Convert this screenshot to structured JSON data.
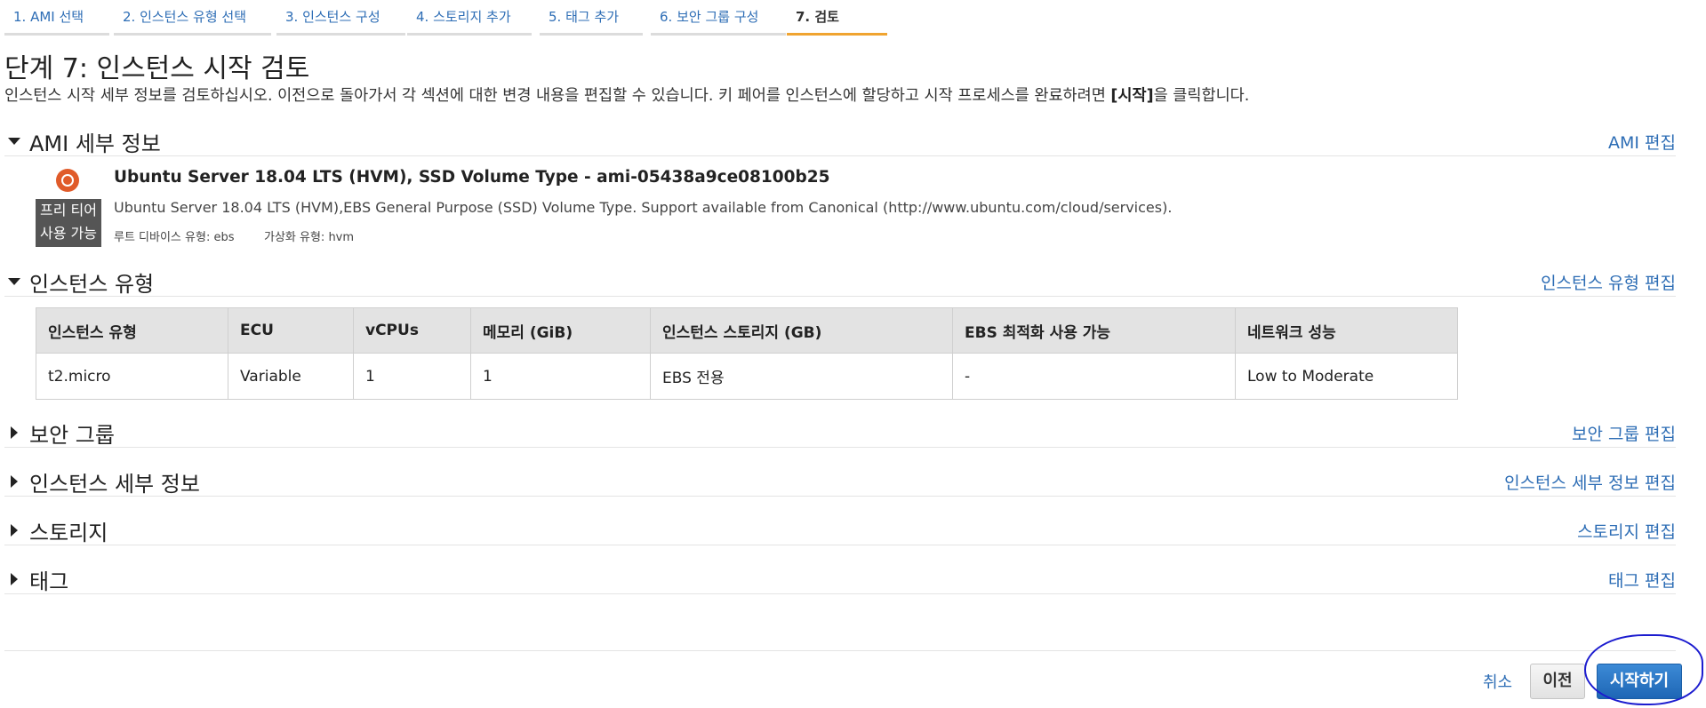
{
  "tabs": [
    {
      "label": "1. AMI 선택"
    },
    {
      "label": "2. 인스턴스 유형 선택"
    },
    {
      "label": "3. 인스턴스 구성"
    },
    {
      "label": "4. 스토리지 추가"
    },
    {
      "label": "5. 태그 추가"
    },
    {
      "label": "6. 보안 그룹 구성"
    },
    {
      "label": "7. 검토"
    }
  ],
  "active_tab_color": "#f0a430",
  "link_color": "#2d6db5",
  "page": {
    "title": "단계 7: 인스턴스 시작 검토",
    "desc_before": "인스턴스 시작 세부 정보를 검토하십시오. 이전으로 돌아가서 각 섹션에 대한 변경 내용을 편집할 수 있습니다. 키 페어를 인스턴스에 할당하고 시작 프로세스를 완료하려면 ",
    "desc_bold": "[시작]",
    "desc_after": "을 클릭합니다."
  },
  "sections": {
    "ami": {
      "title": "AMI 세부 정보",
      "edit": "AMI 편집",
      "expanded": true
    },
    "instance_type": {
      "title": "인스턴스 유형",
      "edit": "인스턴스 유형 편집",
      "expanded": true
    },
    "security_group": {
      "title": "보안 그룹",
      "edit": "보안 그룹 편집",
      "expanded": false
    },
    "instance_details": {
      "title": "인스턴스 세부 정보",
      "edit": "인스턴스 세부 정보 편집",
      "expanded": false
    },
    "storage": {
      "title": "스토리지",
      "edit": "스토리지 편집",
      "expanded": false
    },
    "tags": {
      "title": "태그",
      "edit": "태그 편집",
      "expanded": false
    }
  },
  "ami": {
    "icon": "ubuntu-logo-icon",
    "badge_line1": "프리 티어",
    "badge_line2": "사용 가능",
    "name": "Ubuntu Server 18.04 LTS (HVM), SSD Volume Type - ami-05438a9ce08100b25",
    "description": "Ubuntu Server 18.04 LTS (HVM),EBS General Purpose (SSD) Volume Type. Support available from Canonical (http://www.ubuntu.com/cloud/services).",
    "root_device": "루트 디바이스 유형: ebs",
    "virtualization": "가상화 유형: hvm"
  },
  "instance_table": {
    "headers": [
      "인스턴스 유형",
      "ECU",
      "vCPUs",
      "메모리 (GiB)",
      "인스턴스 스토리지 (GB)",
      "EBS 최적화 사용 가능",
      "네트워크 성능"
    ],
    "rows": [
      [
        "t2.micro",
        "Variable",
        "1",
        "1",
        "EBS 전용",
        "-",
        "Low to Moderate"
      ]
    ]
  },
  "footer": {
    "cancel": "취소",
    "previous": "이전",
    "launch": "시작하기"
  }
}
